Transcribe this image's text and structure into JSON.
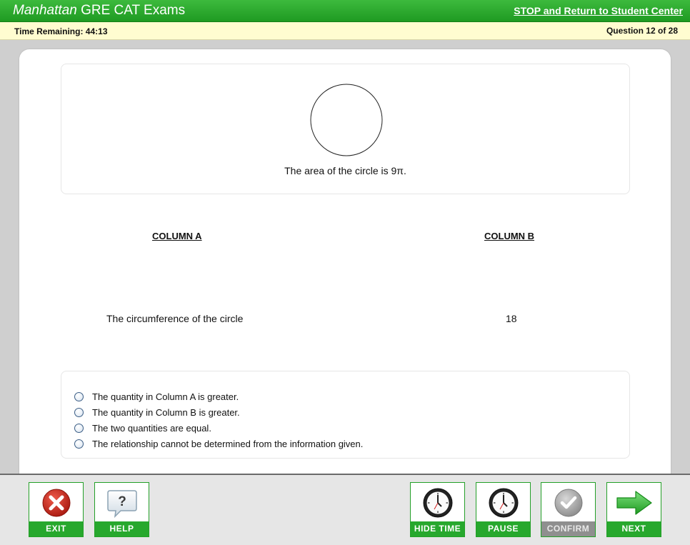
{
  "header": {
    "brand_italic": "Manhattan",
    "brand_rest": " GRE CAT Exams",
    "stop_link": "STOP and Return to Student Center"
  },
  "status": {
    "time_remaining": "Time Remaining: 44:13",
    "question_counter": "Question 12 of 28"
  },
  "question": {
    "stem": "The area of the circle is 9π.",
    "column_a_header": "COLUMN A",
    "column_b_header": "COLUMN B",
    "column_a_value": "The circumference of the circle",
    "column_b_value": "18",
    "choices": [
      "The quantity in Column A is greater.",
      "The quantity in Column B is greater.",
      "The two quantities are equal.",
      "The relationship cannot be determined from the information given."
    ]
  },
  "buttons": {
    "exit": "EXIT",
    "help": "HELP",
    "hide_time": "HIDE TIME",
    "pause": "PAUSE",
    "confirm": "CONFIRM",
    "next": "NEXT"
  },
  "icons": {
    "exit": "close-icon",
    "help": "help-bubble-icon",
    "hide_time": "clock-icon",
    "pause": "clock-icon",
    "confirm": "checkmark-icon",
    "next": "arrow-right-icon"
  },
  "colors": {
    "brand_green": "#27a82d",
    "status_bar": "#fffcd0",
    "exit_red": "#c8261b",
    "disabled_gray": "#8f8f8f"
  }
}
